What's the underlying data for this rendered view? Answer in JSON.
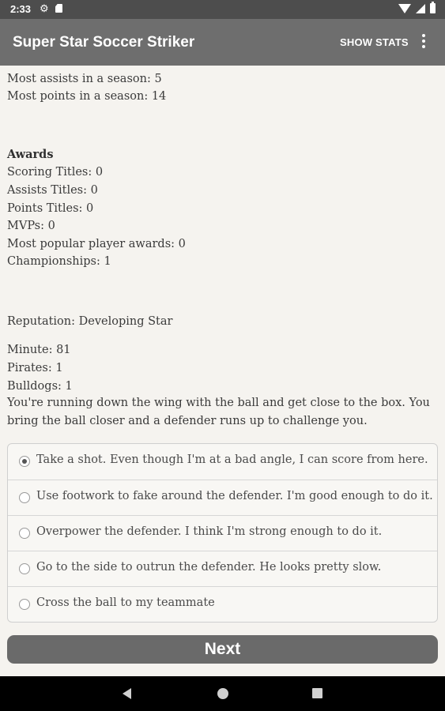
{
  "status_bar": {
    "time": "2:33",
    "icons": [
      "gear-icon",
      "sd-card-icon",
      "wifi-icon",
      "signal-icon",
      "battery-icon"
    ]
  },
  "app_bar": {
    "title": "Super Star Soccer Striker",
    "action": "SHOW STATS",
    "overflow_icon": "more-vert-icon"
  },
  "stats": {
    "most_assists": "Most assists in a season: 5",
    "most_points": "Most points in a season: 14"
  },
  "awards": {
    "heading": "Awards",
    "items": [
      "Scoring Titles: 0",
      "Assists Titles: 0",
      "Points Titles: 0",
      "MVPs: 0",
      "Most popular player awards: 0",
      "Championships: 1"
    ]
  },
  "reputation": "Reputation: Developing Star",
  "game": {
    "minute": "Minute: 81",
    "team_a": "Pirates: 1",
    "team_b": "Bulldogs: 1",
    "story": "You're running down the wing with the ball and get close to the box. You bring the ball closer and a defender runs up to challenge you."
  },
  "choices": [
    {
      "label": "Take a shot. Even though I'm at a bad angle, I can score from here.",
      "selected": true
    },
    {
      "label": "Use footwork to fake around the defender. I'm good enough to do it.",
      "selected": false
    },
    {
      "label": "Overpower the defender. I think I'm strong enough to do it.",
      "selected": false
    },
    {
      "label": "Go to the side to outrun the defender. He looks pretty slow.",
      "selected": false
    },
    {
      "label": "Cross the ball to my teammate",
      "selected": false
    }
  ],
  "next_label": "Next",
  "colors": {
    "app_bar": "#6e6e6e",
    "status_bar": "#4d4d4d",
    "background": "#f5f3ef",
    "button": "#6a6a6a"
  }
}
